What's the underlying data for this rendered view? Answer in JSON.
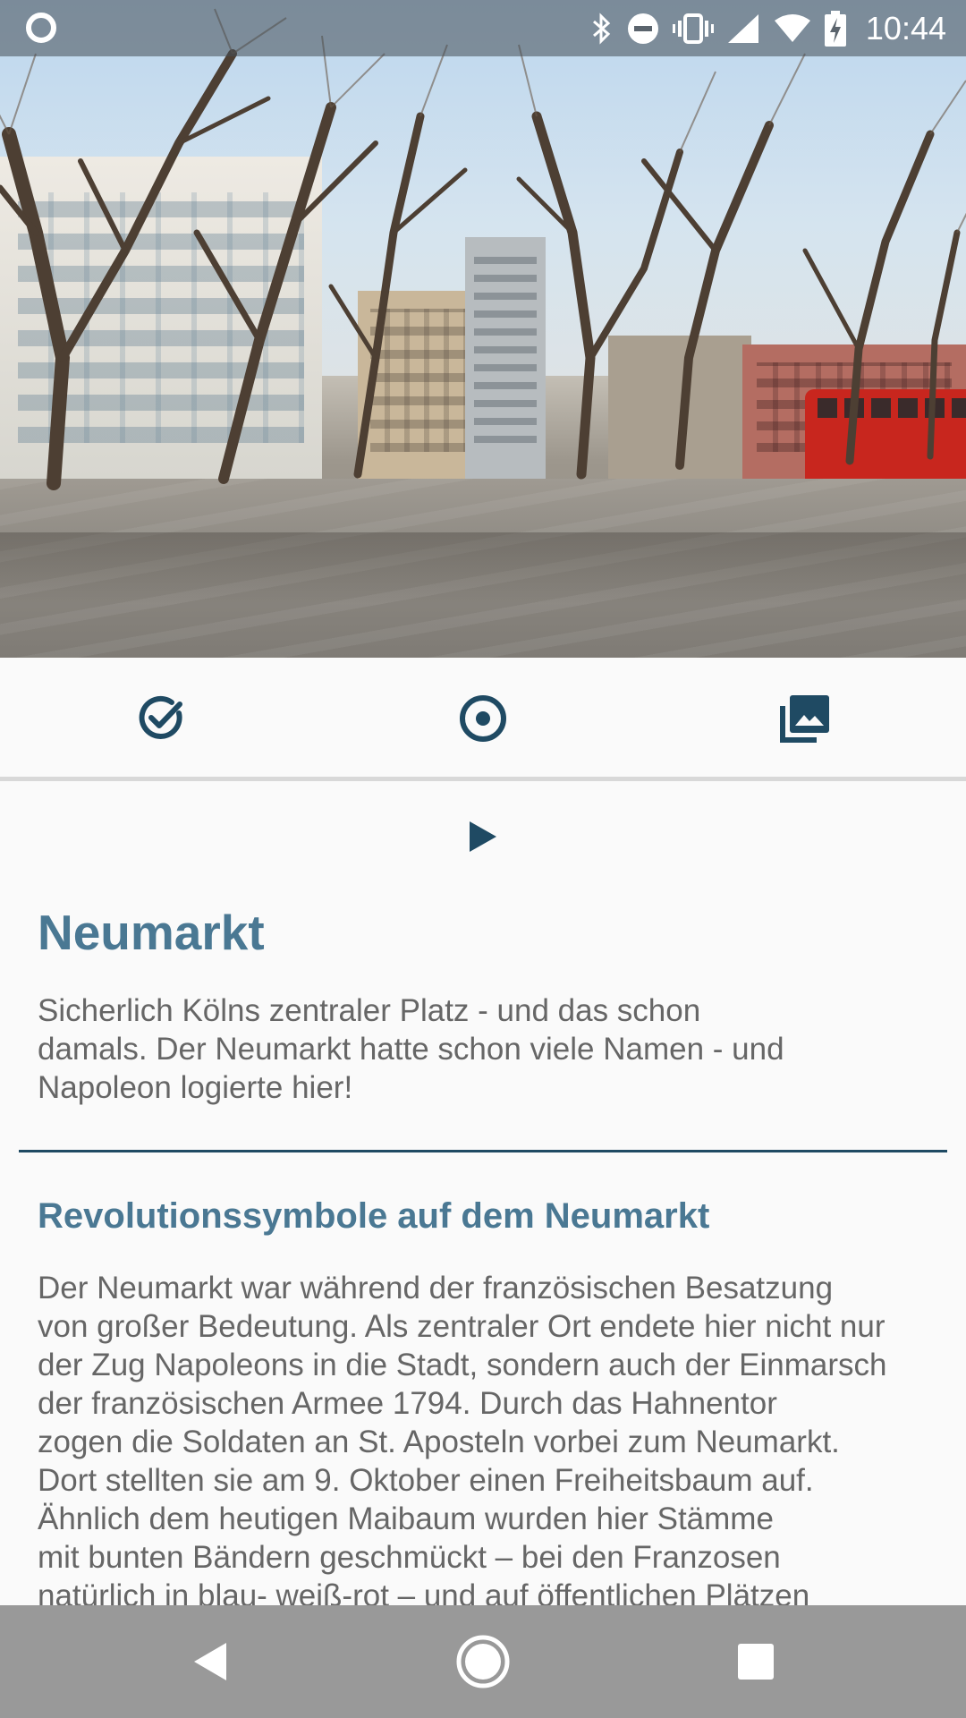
{
  "status_bar": {
    "time": "10:44",
    "icons": [
      "notification-circle-icon",
      "bluetooth-icon",
      "do-not-disturb-icon",
      "vibrate-icon",
      "cell-signal-icon",
      "wifi-icon",
      "battery-charging-icon"
    ]
  },
  "hero": {
    "icon": "photo-neumarkt-square"
  },
  "toolbar": {
    "items": [
      {
        "icon": "check-circle-icon"
      },
      {
        "icon": "location-pin-icon"
      },
      {
        "icon": "photo-library-icon"
      }
    ]
  },
  "audio": {
    "icon": "play-icon"
  },
  "place": {
    "title": "Neumarkt",
    "summary": "Sicherlich Kölns zentraler Platz - und das schon\ndamals. Der Neumarkt hatte schon viele Namen - und\nNapoleon logierte hier!"
  },
  "section": {
    "title": "Revolutionssymbole auf dem Neumarkt",
    "body": "Der Neumarkt war während der französischen Besatzung\nvon großer Bedeutung. Als zentraler Ort endete hier nicht nur\nder Zug Napoleons in die Stadt, sondern auch der Einmarsch\nder französischen Armee 1794. Durch das Hahnentor\nzogen die Soldaten an St. Aposteln vorbei zum Neumarkt.\nDort stellten sie am 9. Oktober einen Freiheitsbaum auf.\nÄhnlich dem heutigen Maibaum wurden hier Stämme\nmit bunten Bändern geschmückt – bei den Franzosen\nnatürlich in blau- weiß-rot – und auf öffentlichen Plätzen"
  },
  "nav_bar": {
    "icons": [
      "back-icon",
      "home-icon",
      "recents-icon"
    ]
  },
  "colors": {
    "accent": "#4a7893",
    "dark_accent": "#1f4a63",
    "text": "#666666",
    "background": "#fafafa",
    "nav_bar": "#999999"
  }
}
